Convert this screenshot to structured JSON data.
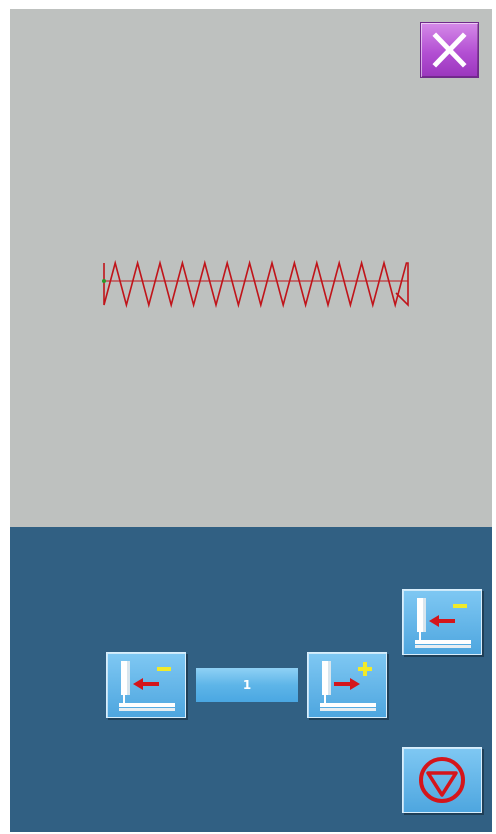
{
  "preview": {
    "background_color": "#bec1bf",
    "stitch_color": "#c0141a",
    "close_icon": "close-x-icon"
  },
  "controls": {
    "background_color": "#316083",
    "top_button_icon": "needle-move-back-minus-icon",
    "left_button_icon": "needle-move-back-minus-icon",
    "right_button_icon": "needle-move-forward-plus-icon",
    "step_value": "1",
    "stop_icon": "stop-circle-triangle-icon"
  }
}
